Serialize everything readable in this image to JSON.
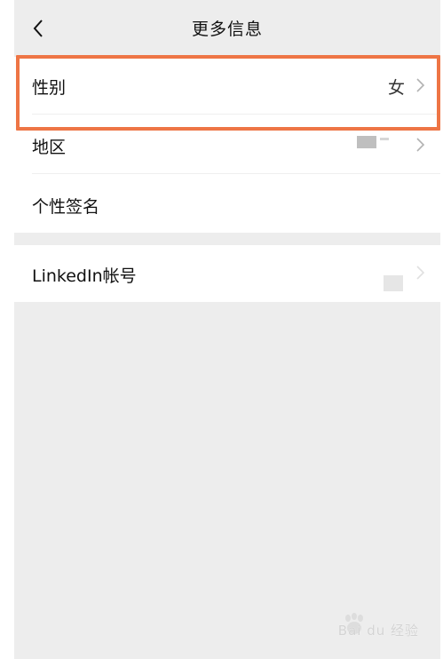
{
  "nav": {
    "title": "更多信息",
    "back_icon": "chevron-left-icon"
  },
  "rows": [
    {
      "label": "性别",
      "value": "女"
    },
    {
      "label": "地区",
      "value": ""
    },
    {
      "label": "个性签名",
      "value": ""
    },
    {
      "label": "LinkedIn帐号",
      "value": ""
    }
  ],
  "watermark": {
    "text": "Bai du 经验"
  },
  "colors": {
    "highlight": "#ee7545",
    "background": "#ededed",
    "card": "#ffffff"
  }
}
